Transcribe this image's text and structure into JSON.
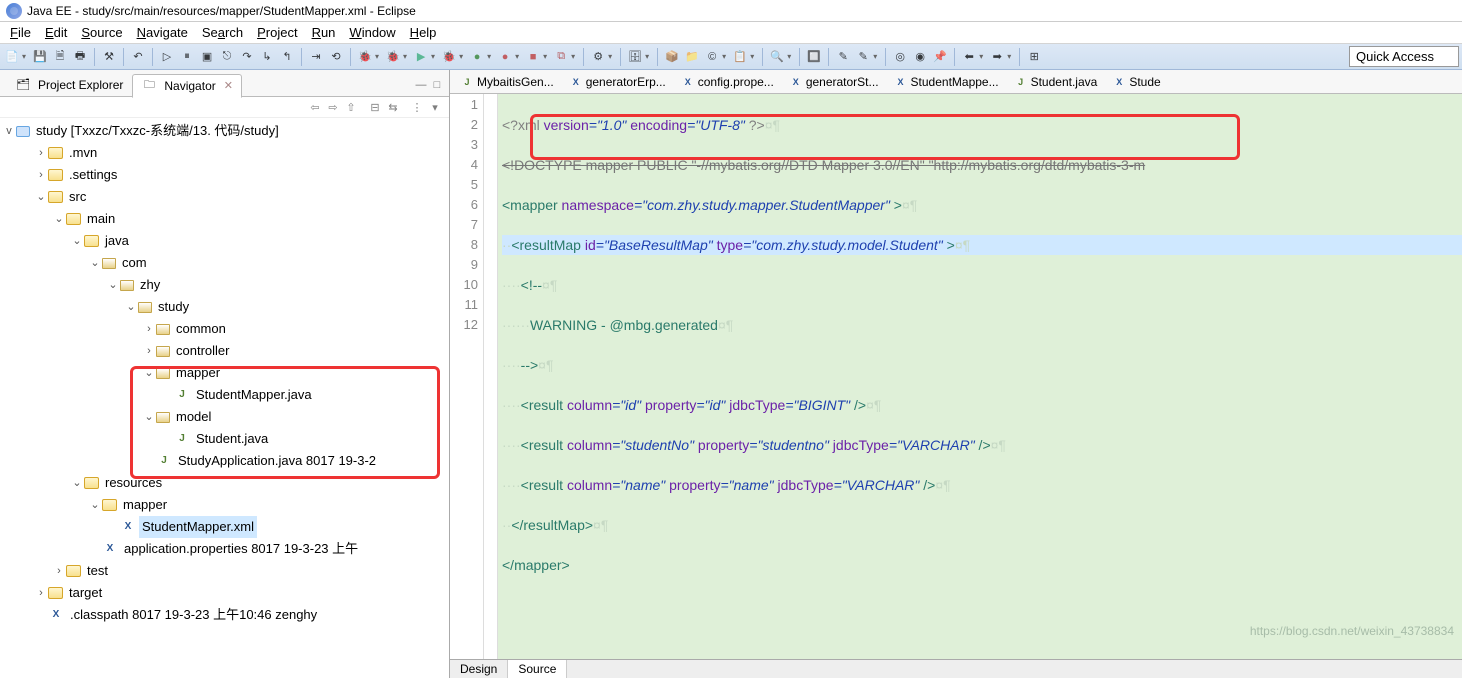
{
  "window": {
    "title": "Java EE - study/src/main/resources/mapper/StudentMapper.xml - Eclipse"
  },
  "menu": [
    "File",
    "Edit",
    "Source",
    "Navigate",
    "Search",
    "Project",
    "Run",
    "Window",
    "Help"
  ],
  "quickAccess": "Quick Access",
  "viewTabs": {
    "inactive": "Project Explorer",
    "active": "Navigator"
  },
  "tree": {
    "root": "study [Txxzc/Txxzc-系统端/13. 代码/study]",
    "items": [
      {
        "d": 1,
        "t": "fld",
        "tw": ">",
        "l": ".mvn"
      },
      {
        "d": 1,
        "t": "fld",
        "tw": ">",
        "l": ".settings"
      },
      {
        "d": 1,
        "t": "fld",
        "tw": "v",
        "l": "src"
      },
      {
        "d": 2,
        "t": "fld",
        "tw": "v",
        "l": "main"
      },
      {
        "d": 3,
        "t": "fld",
        "tw": "v",
        "l": "java"
      },
      {
        "d": 4,
        "t": "pkg",
        "tw": "v",
        "l": "com"
      },
      {
        "d": 5,
        "t": "pkg",
        "tw": "v",
        "l": "zhy"
      },
      {
        "d": 6,
        "t": "pkg",
        "tw": "v",
        "l": "study"
      },
      {
        "d": 7,
        "t": "pkg",
        "tw": ">",
        "l": "common"
      },
      {
        "d": 7,
        "t": "pkg",
        "tw": ">",
        "l": "controller"
      },
      {
        "d": 7,
        "t": "pkg",
        "tw": "v",
        "l": "mapper"
      },
      {
        "d": 8,
        "t": "jfile",
        "tw": "",
        "l": "StudentMapper.java"
      },
      {
        "d": 7,
        "t": "pkg",
        "tw": "v",
        "l": "model"
      },
      {
        "d": 8,
        "t": "jfile",
        "tw": "",
        "l": "Student.java"
      },
      {
        "d": 7,
        "t": "jfile",
        "tw": "",
        "l": "StudyApplication.java 8017  19-3-2"
      },
      {
        "d": 3,
        "t": "fld",
        "tw": "v",
        "l": "resources"
      },
      {
        "d": 4,
        "t": "fld",
        "tw": "v",
        "l": "mapper"
      },
      {
        "d": 5,
        "t": "xml",
        "tw": "",
        "l": "StudentMapper.xml",
        "sel": true
      },
      {
        "d": 4,
        "t": "xml",
        "tw": "",
        "l": "application.properties 8017  19-3-23 上午"
      },
      {
        "d": 2,
        "t": "fld",
        "tw": ">",
        "l": "test"
      },
      {
        "d": 1,
        "t": "fld",
        "tw": ">",
        "l": "target"
      },
      {
        "d": 1,
        "t": "xml",
        "tw": "",
        "l": ".classpath 8017  19-3-23 上午10:46  zenghy"
      }
    ]
  },
  "editorTabs": [
    {
      "i": "j",
      "l": "MybaitisGen..."
    },
    {
      "i": "x",
      "l": "generatorErp..."
    },
    {
      "i": "x",
      "l": "config.prope..."
    },
    {
      "i": "x",
      "l": "generatorSt..."
    },
    {
      "i": "x",
      "l": "StudentMappe..."
    },
    {
      "i": "j",
      "l": "Student.java"
    },
    {
      "i": "x",
      "l": "Stude"
    }
  ],
  "lines": [
    "1",
    "2",
    "3",
    "4",
    "5",
    "6",
    "7",
    "8",
    "9",
    "10",
    "11",
    "12"
  ],
  "code": {
    "l1a": "<?xml ",
    "l1b": "version",
    "l1c": "=\"1.0\"",
    "l1d": " encoding",
    "l1e": "=\"UTF-8\"",
    "l1f": " ?>",
    "l2": "<!DOCTYPE mapper PUBLIC \"-//mybatis.org//DTD Mapper 3.0//EN\" \"http://mybatis.org/dtd/mybatis-3-m",
    "l3a": "<mapper ",
    "l3b": "namespace",
    "l3c": "=\"com.zhy.study.mapper.StudentMapper\"",
    "l3d": " >",
    "sp2": "··",
    "sp4": "····",
    "sp6": "······",
    "l4a": "<resultMap ",
    "l4b": "id",
    "l4c": "=\"BaseResultMap\"",
    "l4d": " type",
    "l4e": "=\"com.zhy.study.model.Student\"",
    "l4f": " >",
    "l5": "<!--",
    "l6": "WARNING - @mbg.generated",
    "l7": "-->",
    "l8a": "<result ",
    "l8b": "column",
    "l8c": "=\"id\"",
    "l8d": " property",
    "l8e": "=\"id\"",
    "l8f": " jdbcType",
    "l8g": "=\"BIGINT\"",
    "l8h": " />",
    "l9a": "<result ",
    "l9b": "column",
    "l9c": "=\"studentNo\"",
    "l9d": " property",
    "l9e": "=\"studentno\"",
    "l9f": " jdbcType",
    "l9g": "=\"VARCHAR\"",
    "l9h": " />",
    "l10a": "<result ",
    "l10b": "column",
    "l10c": "=\"name\"",
    "l10d": " property",
    "l10e": "=\"name\"",
    "l10f": " jdbcType",
    "l10g": "=\"VARCHAR\"",
    "l10h": " />",
    "l11": "</resultMap>",
    "l12": "</mapper>",
    "pm": "¤¶"
  },
  "bottomTabs": {
    "design": "Design",
    "source": "Source"
  },
  "watermark": "https://blog.csdn.net/weixin_43738834"
}
